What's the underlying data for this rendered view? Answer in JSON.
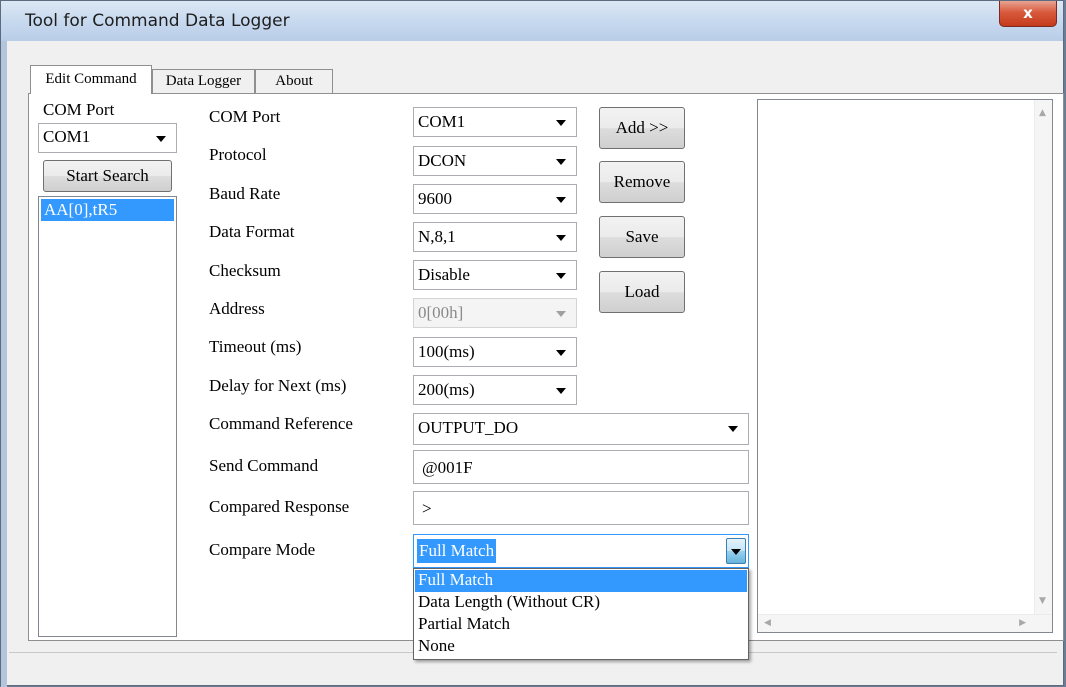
{
  "window": {
    "title": "Tool for Command Data Logger",
    "close_glyph": "x"
  },
  "tabs": [
    {
      "label": "Edit Command",
      "active": true
    },
    {
      "label": "Data Logger",
      "active": false
    },
    {
      "label": "About",
      "active": false
    }
  ],
  "left": {
    "com_port_label": "COM Port",
    "com_port_value": "COM1",
    "search_button": "Start Search",
    "devices": [
      "AA[0],tR5"
    ]
  },
  "form": {
    "com_port": {
      "label": "COM Port",
      "value": "COM1"
    },
    "protocol": {
      "label": "Protocol",
      "value": "DCON"
    },
    "baud_rate": {
      "label": "Baud Rate",
      "value": "9600"
    },
    "data_format": {
      "label": "Data Format",
      "value": "N,8,1"
    },
    "checksum": {
      "label": "Checksum",
      "value": "Disable"
    },
    "address": {
      "label": "Address",
      "value": "0[00h]",
      "disabled": true
    },
    "timeout": {
      "label": "Timeout (ms)",
      "value": "100(ms)"
    },
    "delay": {
      "label": "Delay for Next (ms)",
      "value": "200(ms)"
    },
    "command_reference": {
      "label": "Command Reference",
      "value": "OUTPUT_DO"
    },
    "send_command": {
      "label": "Send Command",
      "value": "@001F"
    },
    "compared_response": {
      "label": "Compared Response",
      "value": ">"
    },
    "compare_mode": {
      "label": "Compare Mode",
      "value": "Full Match",
      "options": [
        "Full Match",
        "Data Length (Without CR)",
        "Partial Match",
        "None"
      ],
      "highlighted": "Full Match"
    }
  },
  "buttons": {
    "add": "Add >>",
    "remove": "Remove",
    "save": "Save",
    "load": "Load"
  },
  "colors": {
    "selection": "#3399ff",
    "title_gradient_top": "#dbe7f4",
    "close_red": "#c43b1c"
  }
}
